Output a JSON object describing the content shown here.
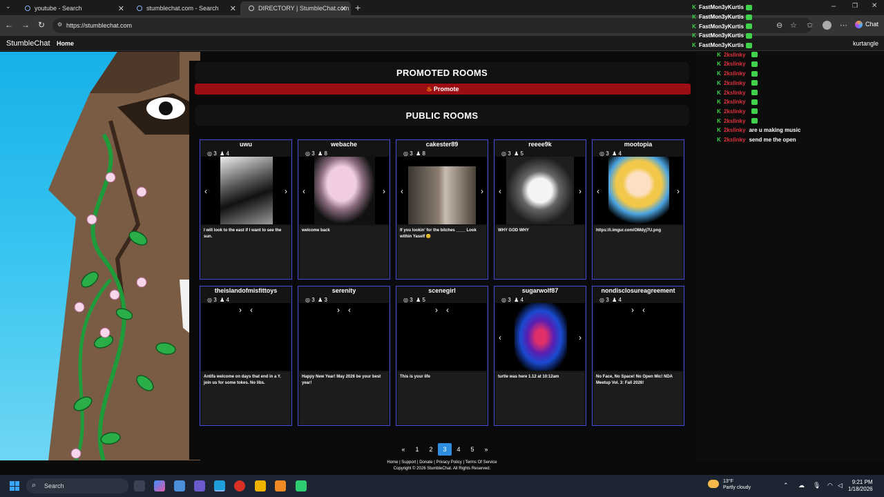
{
  "browser": {
    "tabs": [
      {
        "label": "youtube - Search"
      },
      {
        "label": "stumblechat.com - Search"
      },
      {
        "label": "DIRECTORY | StumbleChat.com"
      }
    ],
    "url": "https://stumblechat.com",
    "chat_button": "Chat"
  },
  "site": {
    "brand": "StumbleChat",
    "home": "Home",
    "username": "kurtangle"
  },
  "directory": {
    "promoted_title": "PROMOTED ROOMS",
    "promote_label": "Promote",
    "public_title": "PUBLIC ROOMS",
    "rooms": [
      {
        "name": "uwu",
        "viewers": "3",
        "users": "4",
        "desc": "I will look to the east if I want to see the sun."
      },
      {
        "name": "webache",
        "viewers": "3",
        "users": "8",
        "desc": "welcome back"
      },
      {
        "name": "cakester89",
        "viewers": "3",
        "users": "8",
        "desc": "If you lookin' for the bitches ____ Look within Yaself 😊"
      },
      {
        "name": "reeee9k",
        "viewers": "3",
        "users": "5",
        "desc": "WHY GOD WHY"
      },
      {
        "name": "mootopia",
        "viewers": "3",
        "users": "4",
        "desc": "https://i.imgur.com/OMdyj7U.png"
      },
      {
        "name": "theislandofmisfittoys",
        "viewers": "3",
        "users": "4",
        "desc": "Antifa welcome on days that end in a Y. join us for some tokes. No libs."
      },
      {
        "name": "serenity",
        "viewers": "3",
        "users": "3",
        "desc": "Happy New Year! May 2026 be your best year!"
      },
      {
        "name": "scenegirl",
        "viewers": "3",
        "users": "5",
        "desc": "This is your life"
      },
      {
        "name": "sugarwolf87",
        "viewers": "3",
        "users": "4",
        "desc": "turtle was here 1.12 at 10:12am"
      },
      {
        "name": "nondisclosureagreement",
        "viewers": "3",
        "users": "4",
        "desc": "No Face, No Space! No Open Mic! NDA Meetup Vol. 3: Fall 2026!"
      }
    ],
    "pagination": [
      "«",
      "1",
      "2",
      "3",
      "4",
      "5",
      "»"
    ],
    "current_page": "3"
  },
  "footer": {
    "links": "Home | Support | Donate | Privacy Policy | Terms Of Service",
    "copyright": "Copyright © 2026 StumbleChat. All Rights Reserved."
  },
  "chat_overlay": {
    "lines": [
      {
        "user": "FastMon3yKurtis",
        "type": "follow"
      },
      {
        "user": "FastMon3yKurtis",
        "type": "follow"
      },
      {
        "user": "FastMon3yKurtis",
        "type": "follow"
      },
      {
        "user": "FastMon3yKurtis",
        "type": "follow"
      },
      {
        "user": "FastMon3yKurtis",
        "type": "follow"
      },
      {
        "user": "2kslinky",
        "type": "gift",
        "text": ""
      },
      {
        "user": "2kslinky",
        "type": "gift",
        "text": ""
      },
      {
        "user": "2kslinky",
        "type": "gift",
        "text": ""
      },
      {
        "user": "2kslinky",
        "type": "gift",
        "text": ""
      },
      {
        "user": "2kslinky",
        "type": "gift",
        "text": ""
      },
      {
        "user": "2kslinky",
        "type": "gift",
        "text": ""
      },
      {
        "user": "2kslinky",
        "type": "gift",
        "text": ""
      },
      {
        "user": "2kslinky",
        "type": "gift",
        "text": ""
      },
      {
        "user": "2kslinky",
        "type": "msg",
        "text": "are u making music"
      },
      {
        "user": "2kslinky",
        "type": "msg",
        "text": "send me the open"
      }
    ]
  },
  "taskbar": {
    "search": "Search",
    "weather_temp": "13°F",
    "weather_desc": "Partly cloudy",
    "time": "9:21 PM",
    "date": "1/18/2026"
  },
  "colors": {
    "accent_red": "#9c0d14",
    "card_border": "#4b4bd9",
    "page_active": "#2e8fe0",
    "chat_green": "#3fd24a",
    "chat_red": "#e0303a"
  }
}
